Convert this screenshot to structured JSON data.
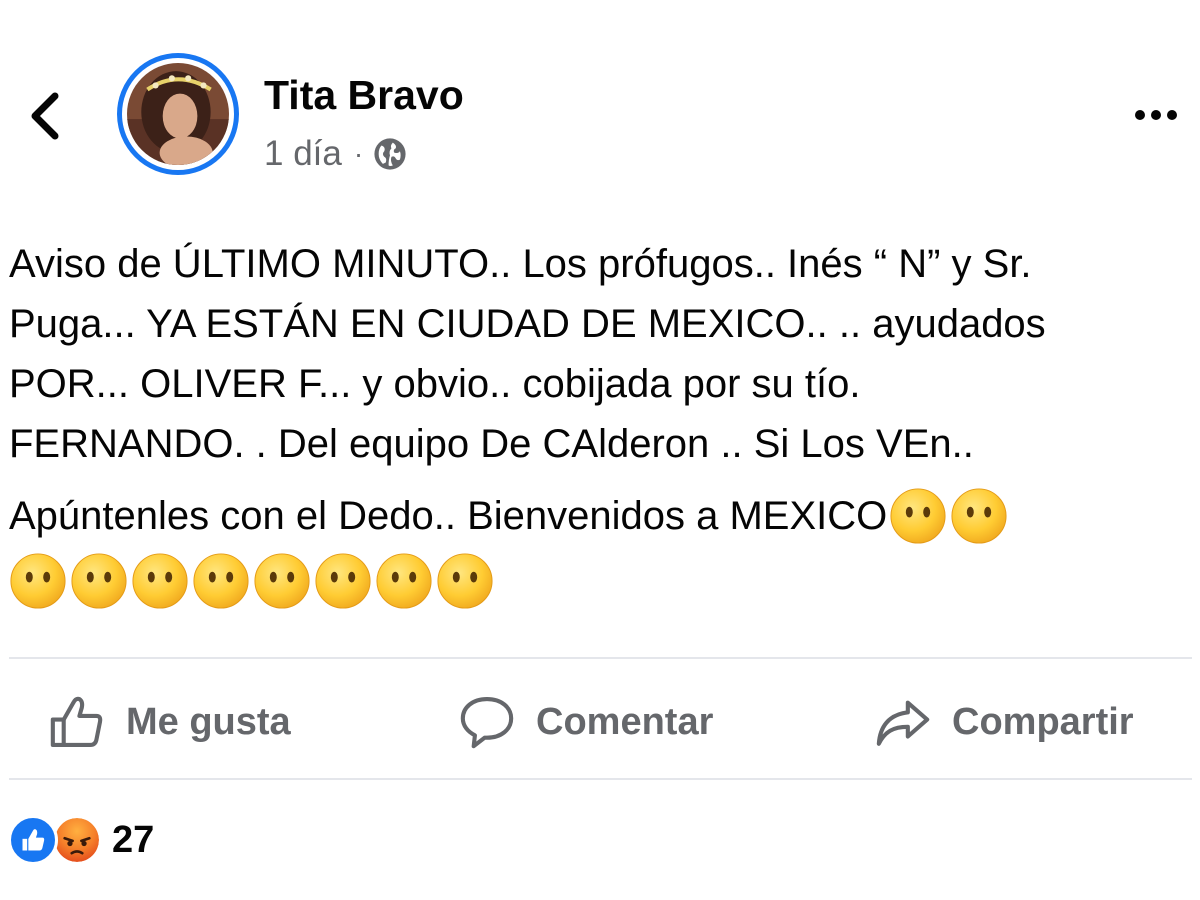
{
  "post": {
    "author": "Tita Bravo",
    "time": "1 día",
    "separator": "·",
    "privacy_icon": "globe-icon",
    "text_lines": [
      "Aviso de ÚLTIMO MINUTO.. Los prófugos.. Inés “ N” y Sr.",
      "Puga... YA ESTÁN EN CIUDAD DE MEXICO.. .. ayudados",
      "POR... OLIVER F... y obvio.. cobijada por su tío.",
      "FERNANDO. . Del equipo De CAlderon .. Si Los VEn..",
      "Apúntenles con el Dedo.. Bienvenidos a MEXICO"
    ],
    "emoji": "face-without-mouth",
    "emoji_count_inline": 2,
    "emoji_count_row": 8
  },
  "actions": {
    "like": "Me gusta",
    "comment": "Comentar",
    "share": "Compartir"
  },
  "reactions": {
    "types": [
      "like",
      "angry"
    ],
    "count": "27"
  },
  "colors": {
    "accent": "#1877f2",
    "secondary_text": "#65676b",
    "divider": "#e4e6eb",
    "emoji_yellow": "#ffcc33"
  }
}
